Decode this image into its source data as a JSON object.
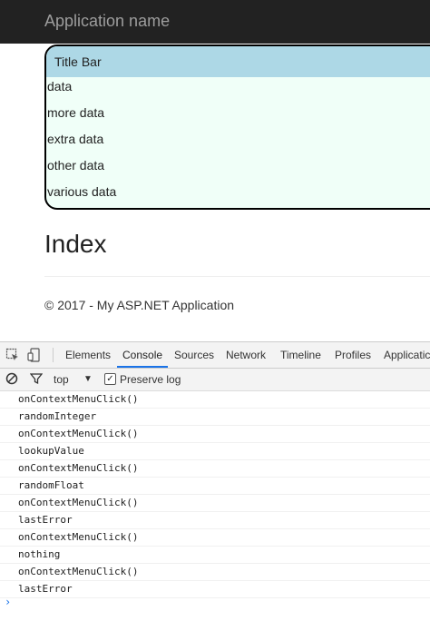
{
  "app": {
    "brand": "Application name"
  },
  "panel": {
    "title": "Title Bar",
    "items": [
      "data",
      "more data",
      "extra data",
      "other data",
      "various data"
    ]
  },
  "page": {
    "heading": "Index",
    "footer": "© 2017 - My ASP.NET Application"
  },
  "devtools": {
    "tabs": [
      "Elements",
      "Console",
      "Sources",
      "Network",
      "Timeline",
      "Profiles",
      "Applicatic"
    ],
    "active_tab": "Console",
    "toolbar": {
      "context": "top",
      "preserve_log": "Preserve log"
    },
    "console_lines": [
      "onContextMenuClick()",
      "randomInteger",
      "onContextMenuClick()",
      "lookupValue",
      "onContextMenuClick()",
      "randomFloat",
      "onContextMenuClick()",
      "lastError",
      "onContextMenuClick()",
      "nothing",
      "onContextMenuClick()",
      "lastError"
    ],
    "prompt_symbol": "›"
  },
  "colors": {
    "navbar": "#222222",
    "title_bar": "#add8e6",
    "panel_bg": "#f0fff8"
  }
}
